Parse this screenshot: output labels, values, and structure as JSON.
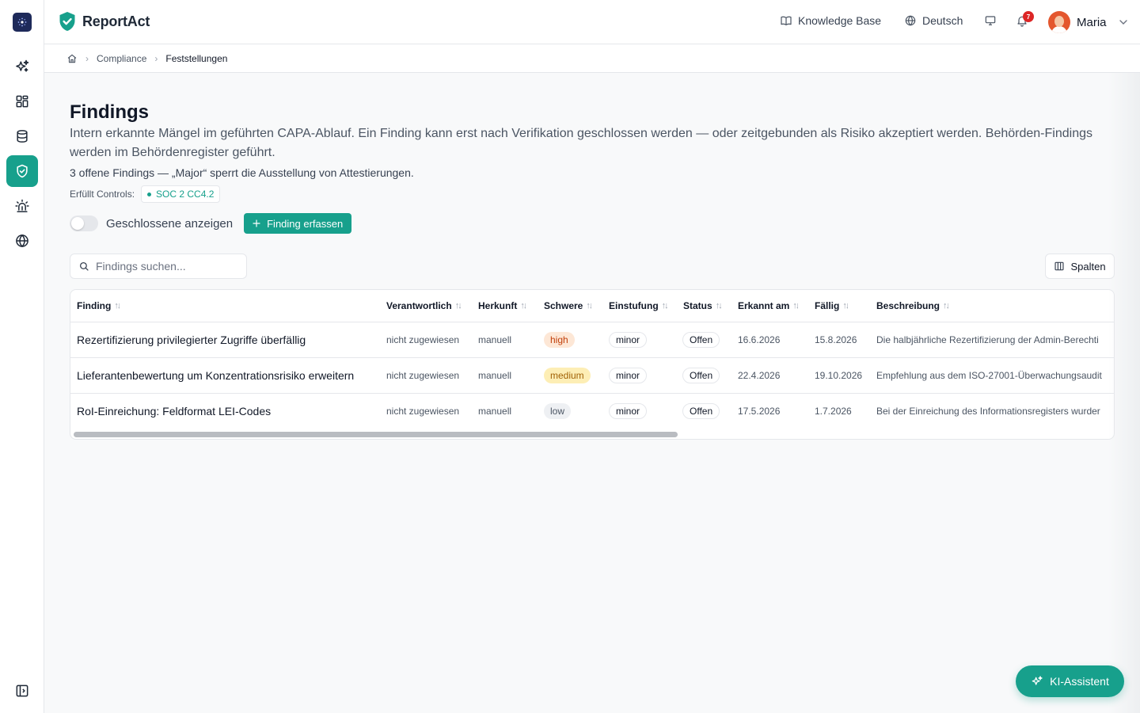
{
  "app": {
    "name": "ReportAct"
  },
  "header": {
    "knowledge_base": "Knowledge Base",
    "language": "Deutsch",
    "notification_count": "7",
    "user_name": "Maria"
  },
  "breadcrumb": {
    "items": [
      "Compliance",
      "Feststellungen"
    ]
  },
  "page": {
    "title": "Findings",
    "description": "Intern erkannte Mängel im geführten CAPA-Ablauf. Ein Finding kann erst nach Verifikation geschlossen werden — oder zeitgebunden als Risiko akzeptiert werden. Behörden-Findings werden im Behördenregister geführt.",
    "summary": "3 offene Findings — „Major“ sperrt die Ausstellung von Attestierungen.",
    "controls_label": "Erfüllt Controls:",
    "control_chip": "SOC 2 CC4.2",
    "toggle_label": "Geschlossene anzeigen",
    "toggle_on": false,
    "add_button": "Finding erfassen"
  },
  "search": {
    "placeholder": "Findings suchen..."
  },
  "columns_button": "Spalten",
  "table": {
    "headers": [
      "Finding",
      "Verantwortlich",
      "Herkunft",
      "Schwere",
      "Einstufung",
      "Status",
      "Erkannt am",
      "Fällig",
      "Beschreibung"
    ],
    "rows": [
      {
        "finding": "Rezertifizierung privilegierter Zugriffe überfällig",
        "owner": "nicht zugewiesen",
        "origin": "manuell",
        "severity": "high",
        "classification": "minor",
        "status": "Offen",
        "detected": "16.6.2026",
        "due": "15.8.2026",
        "description": "Die halbjährliche Rezertifizierung der Admin-Berechti"
      },
      {
        "finding": "Lieferantenbewertung um Konzentrationsrisiko erweitern",
        "owner": "nicht zugewiesen",
        "origin": "manuell",
        "severity": "medium",
        "classification": "minor",
        "status": "Offen",
        "detected": "22.4.2026",
        "due": "19.10.2026",
        "description": "Empfehlung aus dem ISO-27001-Überwachungsaudit"
      },
      {
        "finding": "RoI-Einreichung: Feldformat LEI-Codes",
        "owner": "nicht zugewiesen",
        "origin": "manuell",
        "severity": "low",
        "classification": "minor",
        "status": "Offen",
        "detected": "17.5.2026",
        "due": "1.7.2026",
        "description": "Bei der Einreichung des Informationsregisters wurder"
      }
    ]
  },
  "ai_assistant": "KI-Assistent",
  "colors": {
    "accent": "#17a08c",
    "brand_dark": "#1e2a5a",
    "danger": "#dc2626"
  }
}
